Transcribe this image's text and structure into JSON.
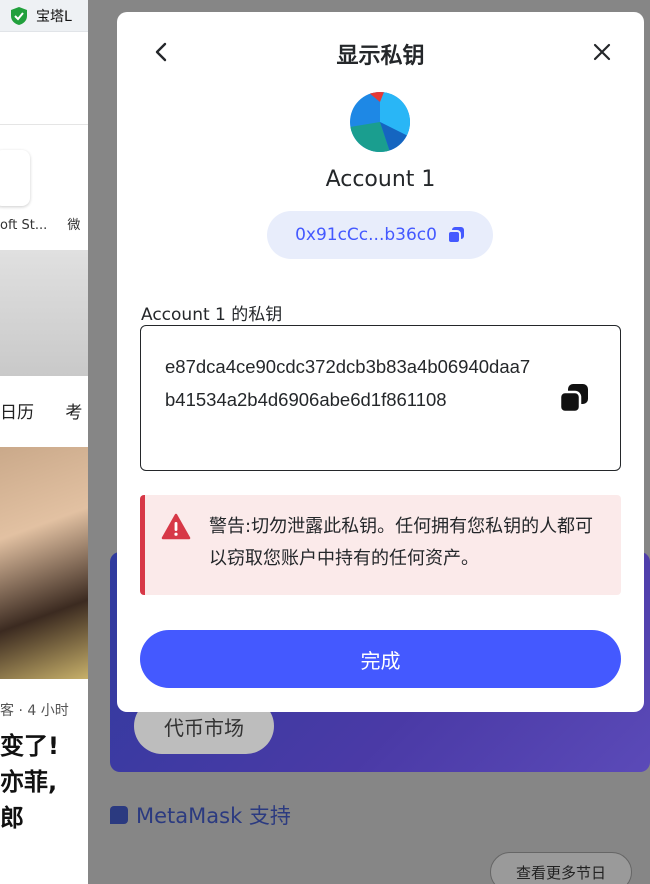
{
  "background": {
    "tab_title": "宝塔L",
    "tile_label": "oft St...",
    "tile_label_2": "微",
    "nav_label": "日历",
    "nav_label_2": "考",
    "news_meta": "客 · 4 小时",
    "news_title_lines": [
      "变了! ",
      "亦菲,",
      "郎"
    ],
    "promo_button": "代币市场",
    "support_label": "MetaMask 支持",
    "more_button": "查看更多节日"
  },
  "modal": {
    "title": "显示私钥",
    "back_icon": "chevron-left-icon",
    "close_icon": "close-icon",
    "account_name": "Account 1",
    "address_short": "0x91cCc...b36c0",
    "key_label": "Account 1 的私钥",
    "private_key": "e87dca4ce90cdc372dcb3b83a4b06940daa7b41534a2b4d6906abe6d1f861108",
    "warning_text": "警告:切勿泄露此私钥。任何拥有您私钥的人都可以窃取您账户中持有的任何资产。",
    "done_label": "完成"
  },
  "colors": {
    "primary": "#4459ff",
    "warning_bg": "#fbeaea",
    "warning_accent": "#d73847",
    "address_pill_bg": "#e8edfb"
  }
}
